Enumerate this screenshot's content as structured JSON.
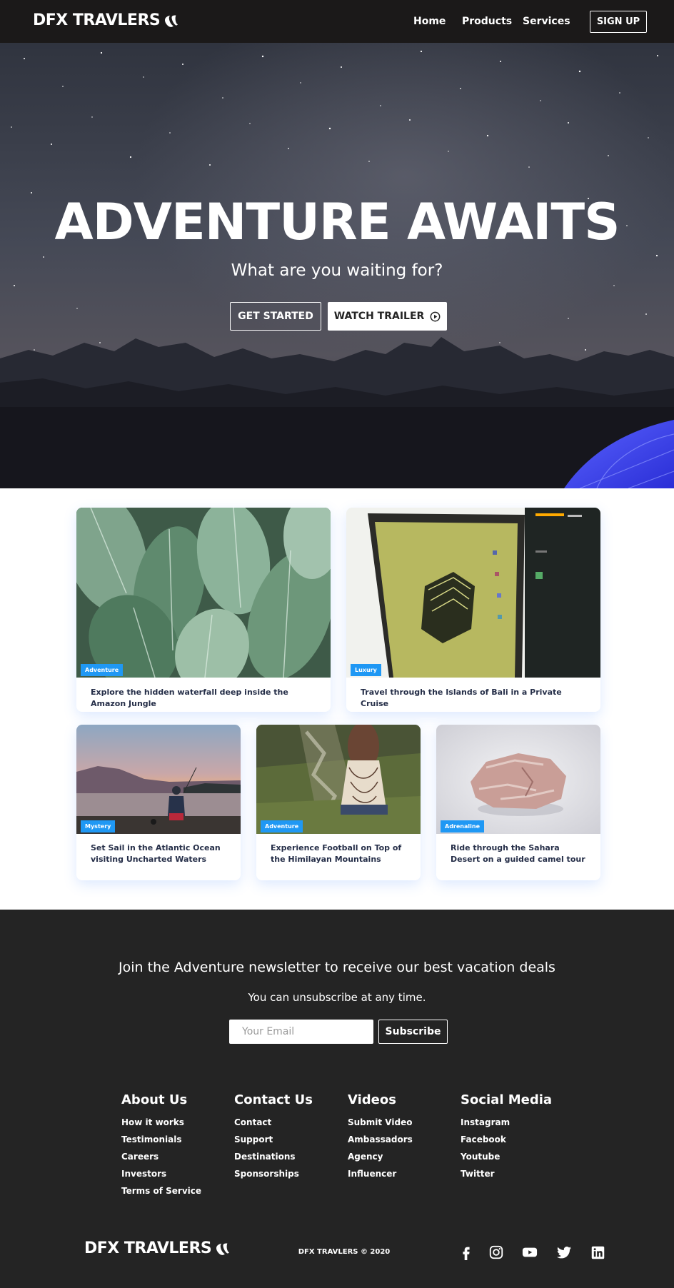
{
  "nav": {
    "brand": "DFX TRAVLERS",
    "links": [
      "Home",
      "Products",
      "Services"
    ],
    "signup": "SIGN UP"
  },
  "hero": {
    "title": "ADVENTURE AWAITS",
    "subtitle": "What are you waiting for?",
    "primary_button": "GET STARTED",
    "secondary_button": "WATCH TRAILER",
    "secondary_icon": "play-circle-icon"
  },
  "cards": [
    {
      "tag": "Adventure",
      "text": "Explore the hidden waterfall deep inside the Amazon Jungle",
      "image": "tropical-leaves"
    },
    {
      "tag": "Luxury",
      "text": "Travel through the Islands of Bali in a Private Cruise",
      "image": "laptop-screen"
    },
    {
      "tag": "Mystery",
      "text": "Set Sail in the Atlantic Ocean visiting Uncharted Waters",
      "image": "lake-fisherman-sunset"
    },
    {
      "tag": "Adventure",
      "text": "Experience Football on Top of the Himilayan Mountains",
      "image": "woman-on-hillside"
    },
    {
      "tag": "Adrenaline",
      "text": "Ride through the Sahara Desert on a guided camel tour",
      "image": "pink-rock"
    }
  ],
  "newsletter": {
    "heading": "Join the Adventure newsletter to receive our best vacation deals",
    "subtext": "You can unsubscribe at any time.",
    "placeholder": "Your Email",
    "button": "Subscribe"
  },
  "footer_columns": [
    {
      "title": "About Us",
      "links": [
        "How it works",
        "Testimonials",
        "Careers",
        "Investors",
        "Terms of Service"
      ]
    },
    {
      "title": "Contact Us",
      "links": [
        "Contact",
        "Support",
        "Destinations",
        "Sponsorships"
      ]
    },
    {
      "title": "Videos",
      "links": [
        "Submit Video",
        "Ambassadors",
        "Agency",
        "Influencer"
      ]
    },
    {
      "title": "Social Media",
      "links": [
        "Instagram",
        "Facebook",
        "Youtube",
        "Twitter"
      ]
    }
  ],
  "footer": {
    "brand": "DFX TRAVLERS",
    "copyright": "DFX TRAVLERS © 2020",
    "social_icons": [
      "facebook-icon",
      "instagram-icon",
      "youtube-icon",
      "twitter-icon",
      "linkedin-icon"
    ]
  },
  "colors": {
    "nav_bg": "#1b1919",
    "footer_bg": "#242424",
    "tag_blue": "#1f98f4",
    "card_text": "#252e48"
  }
}
